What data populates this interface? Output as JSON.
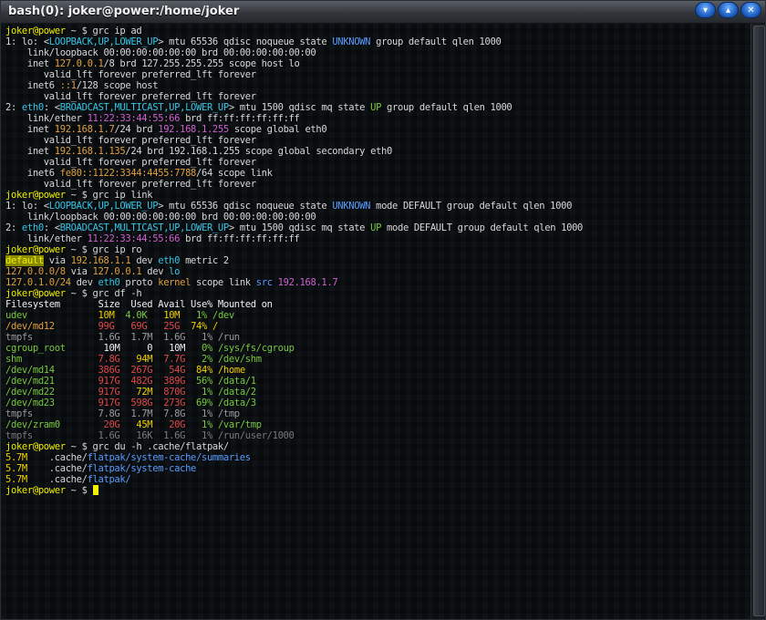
{
  "window": {
    "title": "bash(0): joker@power:/home/joker"
  },
  "palette": {
    "default": "#d8d8d8",
    "prompt_user": "#f0f000",
    "blue": "#5a9dff",
    "cyan": "#35c6e6",
    "red": "#e04848",
    "orange": "#e0a040",
    "yellow": "#f0d000",
    "green": "#78c840",
    "magenta": "#d060d0",
    "gray": "#9a9a9a",
    "dim": "#7a7a7a",
    "white": "#f0f0f0",
    "hl_bg": "#8a8a00"
  },
  "lines": [
    [
      [
        "joker@power",
        "prompt_user"
      ],
      [
        " ~ $ grc ip ad",
        "default"
      ]
    ],
    [
      [
        "1: lo: <",
        "default"
      ],
      [
        "LOOPBACK,UP,LOWER_UP",
        "cyan"
      ],
      [
        "> mtu 65536 qdisc noqueue state ",
        "default"
      ],
      [
        "UNKNOWN",
        "blue"
      ],
      [
        " group default qlen 1000",
        "default"
      ]
    ],
    [
      [
        "    link/loopback 00:00:00:00:00:00 brd 00:00:00:00:00:00",
        "default"
      ]
    ],
    [
      [
        "    inet ",
        "default"
      ],
      [
        "127.0.0.1",
        "orange"
      ],
      [
        "/8 brd 127.255.255.255 scope host lo",
        "default"
      ]
    ],
    [
      [
        "       valid_lft forever preferred_lft forever",
        "default"
      ]
    ],
    [
      [
        "    inet6 ",
        "default"
      ],
      [
        "::1",
        "orange"
      ],
      [
        "/128 scope host",
        "default"
      ]
    ],
    [
      [
        "       valid_lft forever preferred_lft forever",
        "default"
      ]
    ],
    [
      [
        "2: ",
        "default"
      ],
      [
        "eth0",
        "cyan"
      ],
      [
        ": <",
        "default"
      ],
      [
        "BROADCAST,MULTICAST,UP,LOWER_UP",
        "cyan"
      ],
      [
        "> mtu 1500 qdisc mq state ",
        "default"
      ],
      [
        "UP",
        "green"
      ],
      [
        " group default qlen 1000",
        "default"
      ]
    ],
    [
      [
        "    link/ether ",
        "default"
      ],
      [
        "11:22:33:44:55:66",
        "magenta"
      ],
      [
        " brd ff:ff:ff:ff:ff:ff",
        "default"
      ]
    ],
    [
      [
        "    inet ",
        "default"
      ],
      [
        "192.168.1.7",
        "orange"
      ],
      [
        "/24 brd ",
        "default"
      ],
      [
        "192.168.1.255",
        "magenta"
      ],
      [
        " scope global eth0",
        "default"
      ]
    ],
    [
      [
        "       valid_lft forever preferred_lft forever",
        "default"
      ]
    ],
    [
      [
        "    inet ",
        "default"
      ],
      [
        "192.168.1.135",
        "orange"
      ],
      [
        "/24 brd 192.168.1.255 scope global secondary eth0",
        "default"
      ]
    ],
    [
      [
        "       valid_lft forever preferred_lft forever",
        "default"
      ]
    ],
    [
      [
        "    inet6 ",
        "default"
      ],
      [
        "fe80::1122:3344:4455:7788",
        "orange"
      ],
      [
        "/64 scope link",
        "default"
      ]
    ],
    [
      [
        "       valid_lft forever preferred_lft forever",
        "default"
      ]
    ],
    [
      [
        "joker@power",
        "prompt_user"
      ],
      [
        " ~ $ grc ip link",
        "default"
      ]
    ],
    [
      [
        "1: lo: <",
        "default"
      ],
      [
        "LOOPBACK,UP,LOWER_UP",
        "cyan"
      ],
      [
        "> mtu 65536 qdisc noqueue state ",
        "default"
      ],
      [
        "UNKNOWN",
        "blue"
      ],
      [
        " mode DEFAULT group default qlen 1000",
        "default"
      ]
    ],
    [
      [
        "    link/loopback 00:00:00:00:00:00 brd 00:00:00:00:00:00",
        "default"
      ]
    ],
    [
      [
        "2: ",
        "default"
      ],
      [
        "eth0",
        "cyan"
      ],
      [
        ": <",
        "default"
      ],
      [
        "BROADCAST,MULTICAST,UP,LOWER_UP",
        "cyan"
      ],
      [
        "> mtu 1500 qdisc mq state ",
        "default"
      ],
      [
        "UP",
        "green"
      ],
      [
        " mode DEFAULT group default qlen 1000",
        "default"
      ]
    ],
    [
      [
        "    link/ether ",
        "default"
      ],
      [
        "11:22:33:44:55:66",
        "magenta"
      ],
      [
        " brd ff:ff:ff:ff:ff:ff",
        "default"
      ]
    ],
    [
      [
        "joker@power",
        "prompt_user"
      ],
      [
        " ~ $ grc ip ro",
        "default"
      ]
    ],
    [
      [
        "default",
        "hl"
      ],
      [
        " via ",
        "default"
      ],
      [
        "192.168.1.1",
        "orange"
      ],
      [
        " dev ",
        "default"
      ],
      [
        "eth0",
        "cyan"
      ],
      [
        " metric 2",
        "default"
      ]
    ],
    [
      [
        "127.0.0.0/8",
        "orange"
      ],
      [
        " via ",
        "default"
      ],
      [
        "127.0.0.1",
        "orange"
      ],
      [
        " dev ",
        "default"
      ],
      [
        "lo",
        "cyan"
      ]
    ],
    [
      [
        "127.0.1.0/24",
        "orange"
      ],
      [
        " dev ",
        "default"
      ],
      [
        "eth0",
        "cyan"
      ],
      [
        " proto ",
        "default"
      ],
      [
        "kernel",
        "orange"
      ],
      [
        " scope link ",
        "default"
      ],
      [
        "src",
        "blue"
      ],
      [
        " ",
        "default"
      ],
      [
        "192.168.1.7",
        "magenta"
      ]
    ],
    [
      [
        "joker@power",
        "prompt_user"
      ],
      [
        " ~ $ grc df -h",
        "default"
      ]
    ],
    [
      [
        "Filesystem       Size  Used Avail Use% Mounted on",
        "white"
      ]
    ],
    [
      [
        "udev",
        "green"
      ],
      [
        "             ",
        "default"
      ],
      [
        "10M",
        "yellow"
      ],
      [
        "  ",
        "default"
      ],
      [
        "4.0K",
        "green"
      ],
      [
        "   ",
        "default"
      ],
      [
        "10M",
        "yellow"
      ],
      [
        "   1% ",
        "green"
      ],
      [
        "/dev",
        "green"
      ]
    ],
    [
      [
        "/dev/md12",
        "orange"
      ],
      [
        "        ",
        "default"
      ],
      [
        "99G",
        "red"
      ],
      [
        "   ",
        "default"
      ],
      [
        "69G",
        "red"
      ],
      [
        "   ",
        "default"
      ],
      [
        "25G",
        "red"
      ],
      [
        "  74% ",
        "yellow"
      ],
      [
        "/",
        "yellow"
      ]
    ],
    [
      [
        "tmpfs            1.6G  1.7M  1.6G   1% /run",
        "gray"
      ]
    ],
    [
      [
        "cgroup_root",
        "green"
      ],
      [
        "       ",
        "default"
      ],
      [
        "10M",
        "white"
      ],
      [
        "     ",
        "default"
      ],
      [
        "0",
        "white"
      ],
      [
        "   ",
        "default"
      ],
      [
        "10M",
        "white"
      ],
      [
        "   0% ",
        "green"
      ],
      [
        "/sys/fs/cgroup",
        "green"
      ]
    ],
    [
      [
        "shm",
        "green"
      ],
      [
        "              ",
        "default"
      ],
      [
        "7.8G",
        "red"
      ],
      [
        "   ",
        "default"
      ],
      [
        "94M",
        "yellow"
      ],
      [
        "  ",
        "default"
      ],
      [
        "7.7G",
        "red"
      ],
      [
        "   2% ",
        "green"
      ],
      [
        "/dev/shm",
        "green"
      ]
    ],
    [
      [
        "/dev/md14",
        "green"
      ],
      [
        "        ",
        "default"
      ],
      [
        "386G",
        "red"
      ],
      [
        "  ",
        "default"
      ],
      [
        "267G",
        "red"
      ],
      [
        "   ",
        "default"
      ],
      [
        "54G",
        "red"
      ],
      [
        "  84% ",
        "yellow"
      ],
      [
        "/home",
        "yellow"
      ]
    ],
    [
      [
        "/dev/md21",
        "green"
      ],
      [
        "        ",
        "default"
      ],
      [
        "917G",
        "red"
      ],
      [
        "  ",
        "default"
      ],
      [
        "482G",
        "red"
      ],
      [
        "  ",
        "default"
      ],
      [
        "389G",
        "red"
      ],
      [
        "  56% ",
        "green"
      ],
      [
        "/data/1",
        "green"
      ]
    ],
    [
      [
        "/dev/md22",
        "green"
      ],
      [
        "        ",
        "default"
      ],
      [
        "917G",
        "red"
      ],
      [
        "   ",
        "default"
      ],
      [
        "72M",
        "yellow"
      ],
      [
        "  ",
        "default"
      ],
      [
        "870G",
        "red"
      ],
      [
        "   1% ",
        "green"
      ],
      [
        "/data/2",
        "green"
      ]
    ],
    [
      [
        "/dev/md23",
        "green"
      ],
      [
        "        ",
        "default"
      ],
      [
        "917G",
        "red"
      ],
      [
        "  ",
        "default"
      ],
      [
        "598G",
        "red"
      ],
      [
        "  ",
        "default"
      ],
      [
        "273G",
        "red"
      ],
      [
        "  69% ",
        "green"
      ],
      [
        "/data/3",
        "green"
      ]
    ],
    [
      [
        "tmpfs            7.8G  1.7M  7.8G   1% /tmp",
        "gray"
      ]
    ],
    [
      [
        "/dev/zram0",
        "green"
      ],
      [
        "        ",
        "default"
      ],
      [
        "20G",
        "red"
      ],
      [
        "   ",
        "default"
      ],
      [
        "45M",
        "yellow"
      ],
      [
        "   ",
        "default"
      ],
      [
        "20G",
        "red"
      ],
      [
        "   1% ",
        "green"
      ],
      [
        "/var/tmp",
        "green"
      ]
    ],
    [
      [
        "tmpfs            1.6G   16K  1.6G   1% /run/user/1000",
        "dim"
      ]
    ],
    [
      [
        "joker@power",
        "prompt_user"
      ],
      [
        " ~ $ grc du -h .cache/flatpak/",
        "default"
      ]
    ],
    [
      [
        "5.7M",
        "yellow"
      ],
      [
        "    .cache/",
        "default"
      ],
      [
        "flatpak/system-cache/summaries",
        "blue"
      ]
    ],
    [
      [
        "5.7M",
        "yellow"
      ],
      [
        "    .cache/",
        "default"
      ],
      [
        "flatpak/system-cache",
        "blue"
      ]
    ],
    [
      [
        "5.7M",
        "yellow"
      ],
      [
        "    .cache/",
        "default"
      ],
      [
        "flatpak/",
        "blue"
      ]
    ],
    [
      [
        "joker@power",
        "prompt_user"
      ],
      [
        " ~ $ ",
        "default"
      ],
      [
        "",
        "cursor"
      ]
    ]
  ]
}
